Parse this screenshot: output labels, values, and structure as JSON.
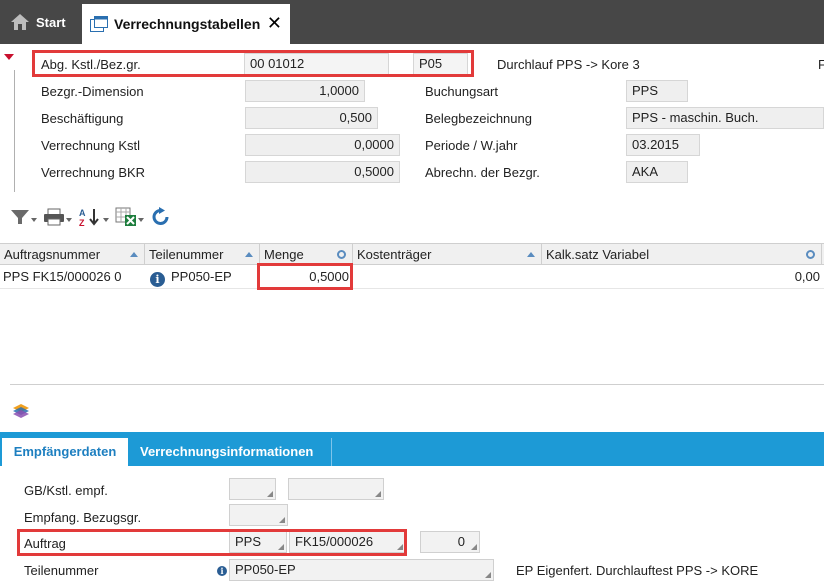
{
  "tabs": {
    "start_label": "Start",
    "active_label": "Verrechnungstabellen"
  },
  "header": {
    "abg_label": "Abg. Kstl./Bez.gr.",
    "abg_value": "00 01012",
    "abg_code": "P05",
    "description": "Durchlauf PPS -> Kore 3",
    "right_edge_char": "F",
    "bezgr_dimension_label": "Bezgr.-Dimension",
    "bezgr_dimension_value": "1,0000",
    "beschaeftigung_label": "Beschäftigung",
    "beschaeftigung_value": "0,500",
    "verrechnung_kstl_label": "Verrechnung Kstl",
    "verrechnung_kstl_value": "0,0000",
    "verrechnung_bkr_label": "Verrechnung BKR",
    "verrechnung_bkr_value": "0,5000",
    "buchungsart_label": "Buchungsart",
    "buchungsart_value": "PPS",
    "belegbezeichnung_label": "Belegbezeichnung",
    "belegbezeichnung_value": "PPS - maschin. Buch.",
    "periode_label": "Periode / W.jahr",
    "periode_value": "03.2015",
    "abrechn_label": "Abrechn. der Bezgr.",
    "abrechn_value": "AKA"
  },
  "toolbar": {
    "icons": [
      "filter-icon",
      "print-icon",
      "sort-az-icon",
      "excel-export-icon",
      "refresh-icon"
    ]
  },
  "grid": {
    "columns": [
      "Auftragsnummer",
      "Teilenummer",
      "Menge",
      "Kostenträger",
      "Kalk.satz Variabel"
    ],
    "rows": [
      {
        "auftragsnummer": "PPS FK15/000026 0",
        "teilenummer": "PP050-EP",
        "menge": "0,5000",
        "kostentraeger": "",
        "kalksatz": "0,00"
      }
    ]
  },
  "lower_tabs": {
    "active": "Empfängerdaten",
    "other": "Verrechnungsinformationen"
  },
  "recipient": {
    "gb_kstl_label": "GB/Kstl. empf.",
    "gb_kstl_value1": "",
    "gb_kstl_value2": "",
    "empfang_label": "Empfang. Bezugsgr.",
    "empfang_value": "",
    "auftrag_label": "Auftrag",
    "auftrag_type": "PPS",
    "auftrag_number": "FK15/000026",
    "auftrag_pos": "0",
    "teilenummer_label": "Teilenummer",
    "teilenummer_value": "PP050-EP",
    "teilenummer_desc": "EP Eigenfert. Durchlauftest PPS -> KORE"
  },
  "colors": {
    "tabbar_bg": "#474747",
    "accent_blue": "#1d9ad6",
    "highlight_red": "#e23a3a"
  }
}
